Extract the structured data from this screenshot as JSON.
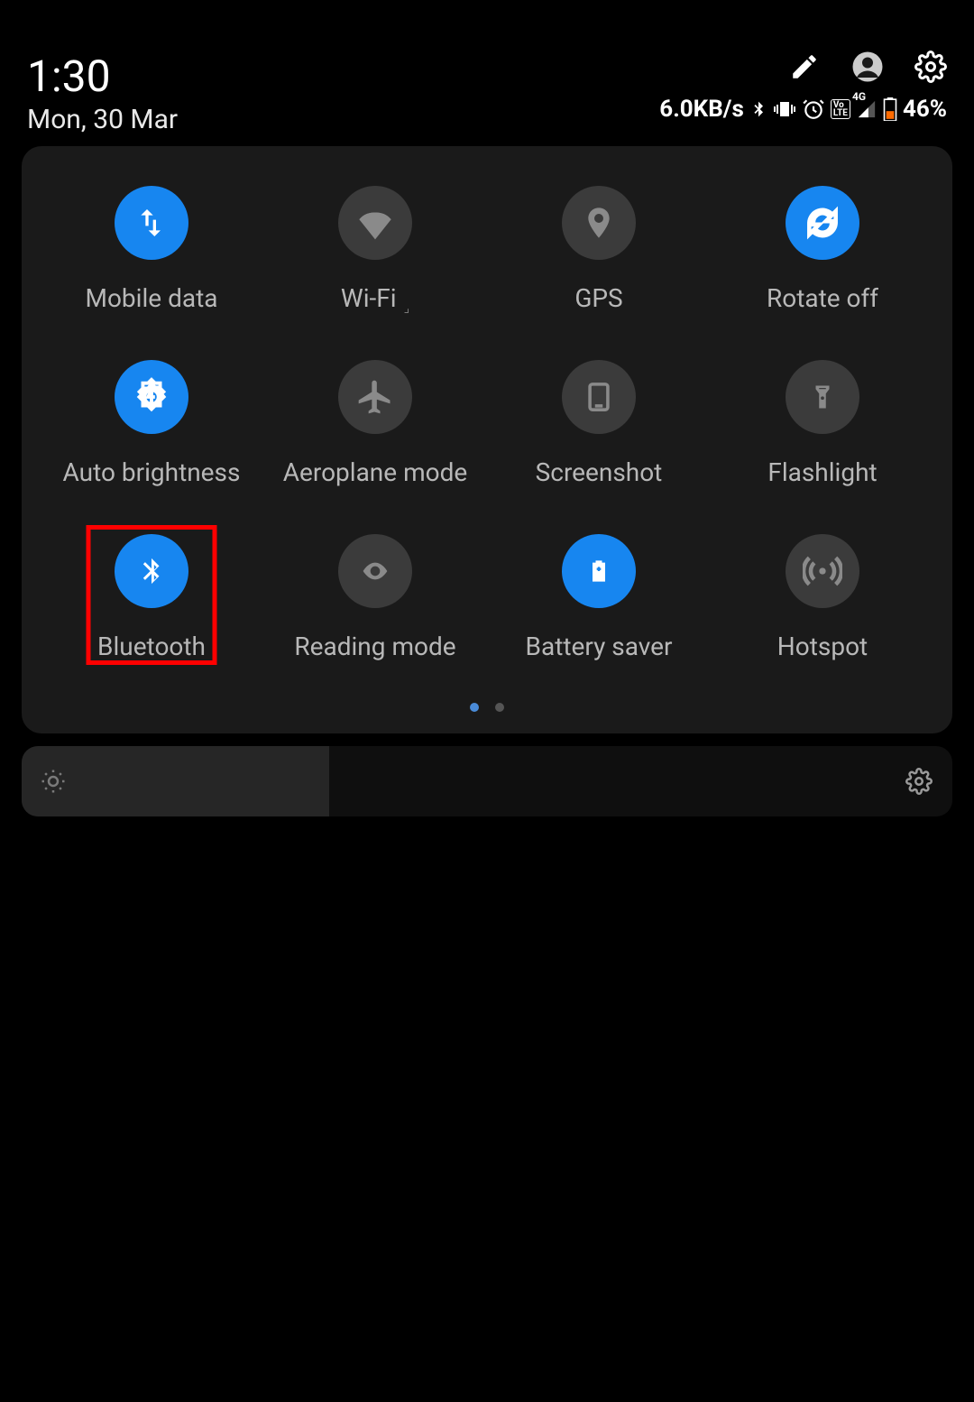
{
  "header": {
    "time": "1:30",
    "date": "Mon, 30 Mar",
    "icons": {
      "edit": "edit-icon",
      "profile": "profile-icon",
      "settings": "settings-icon"
    }
  },
  "status": {
    "data_speed": "6.0KB/s",
    "battery_pct": "46%",
    "network_label": "4G",
    "volte_label": "Vo LTE"
  },
  "tiles": [
    {
      "id": "mobile-data",
      "label": "Mobile data",
      "active": true,
      "icon": "swap-vert-icon",
      "highlighted": false
    },
    {
      "id": "wifi",
      "label": "Wi-Fi",
      "extra": "⌟",
      "active": false,
      "icon": "wifi-icon",
      "highlighted": false
    },
    {
      "id": "gps",
      "label": "GPS",
      "active": false,
      "icon": "location-icon",
      "highlighted": false
    },
    {
      "id": "rotate-off",
      "label": "Rotate off",
      "active": true,
      "icon": "rotate-icon",
      "highlighted": false
    },
    {
      "id": "auto-brightness",
      "label": "Auto brightness",
      "active": true,
      "icon": "brightness-auto-icon",
      "highlighted": false
    },
    {
      "id": "aeroplane-mode",
      "label": "Aeroplane mode",
      "active": false,
      "icon": "airplane-icon",
      "highlighted": false
    },
    {
      "id": "screenshot",
      "label": "Screenshot",
      "active": false,
      "icon": "phone-icon",
      "highlighted": false
    },
    {
      "id": "flashlight",
      "label": "Flashlight",
      "active": false,
      "icon": "flashlight-icon",
      "highlighted": false
    },
    {
      "id": "bluetooth",
      "label": "Bluetooth",
      "active": true,
      "icon": "bluetooth-icon",
      "highlighted": true
    },
    {
      "id": "reading-mode",
      "label": "Reading mode",
      "active": false,
      "icon": "eye-icon",
      "highlighted": false
    },
    {
      "id": "battery-saver",
      "label": "Battery saver",
      "active": true,
      "icon": "battery-plus-icon",
      "highlighted": false
    },
    {
      "id": "hotspot",
      "label": "Hotspot",
      "active": false,
      "icon": "hotspot-icon",
      "highlighted": false
    }
  ],
  "pager": {
    "total": 2,
    "active": 0
  },
  "brightness": {
    "level_pct": 33
  },
  "colors": {
    "active": "#1786f0",
    "inactive": "#3b3b3b",
    "panel": "#1a1a1a",
    "highlight": "#ff0000"
  }
}
